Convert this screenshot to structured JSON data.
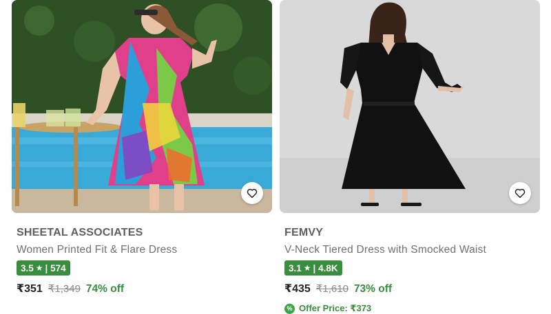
{
  "products": [
    {
      "brand": "SHEETAL ASSOCIATES",
      "title": "Women Printed Fit & Flare Dress",
      "rating": "3.5",
      "rating_count": "| 574",
      "price": "₹351",
      "mrp": "₹1,349",
      "discount": "74% off",
      "image_icon": "dress-photo-icon",
      "wishlist_icon": "heart-outline-icon"
    },
    {
      "brand": "FEMVY",
      "title": "V-Neck Tiered Dress with Smocked Waist",
      "rating": "3.1",
      "rating_count": "| 4.8K",
      "price": "₹435",
      "mrp": "₹1,610",
      "discount": "73% off",
      "offer_price": "Offer Price: ₹373",
      "offer_badge": "%",
      "image_icon": "dress-photo-icon",
      "wishlist_icon": "heart-outline-icon"
    }
  ],
  "colors": {
    "rating_badge": "#388e3c",
    "discount_text": "#388e3c",
    "brand_text": "#5f5f5f"
  }
}
